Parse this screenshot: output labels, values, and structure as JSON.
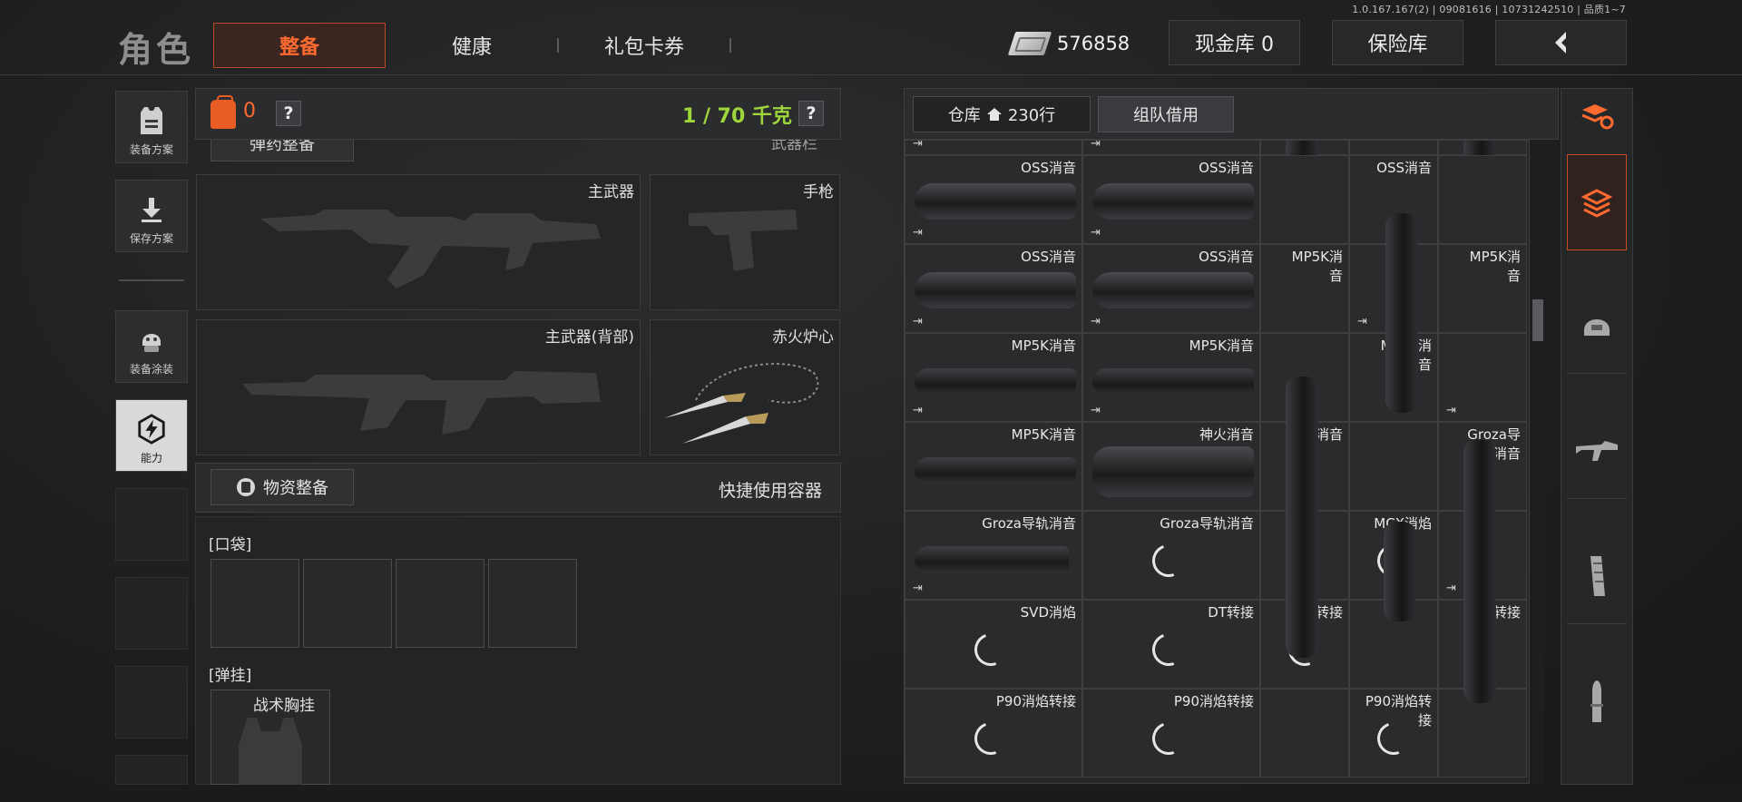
{
  "version": "1.0.167.167(2) | 09081616 | 10731242510 | 品质1~7",
  "header": {
    "title": "角色",
    "tabs": [
      {
        "label": "整备",
        "active": true
      },
      {
        "label": "健康",
        "active": false
      },
      {
        "label": "礼包卡券",
        "active": false
      }
    ],
    "money": "576858",
    "cash_vault": "现金库 0",
    "safe_box": "保险库"
  },
  "left_menu": [
    {
      "label": "装备方案",
      "icon": "vest-icon"
    },
    {
      "label": "保存方案",
      "icon": "download-icon"
    },
    {
      "label": "装备涂装",
      "icon": "helmet-icon"
    },
    {
      "label": "能力",
      "icon": "lightning-icon",
      "active": true
    }
  ],
  "loadout": {
    "backpack_count": "0",
    "help": "?",
    "weight": "1 / 70 千克",
    "peek_button": "弹药整备",
    "peek_right": "武器栏",
    "slots": {
      "primary": "主武器",
      "pistol": "手枪",
      "primary_back": "主武器(背部)",
      "melee": "赤火炉心"
    },
    "supply_button": "物资整备",
    "quick_container": "快捷使用容器",
    "pocket_label": "[口袋]",
    "rig_label": "[弹挂]",
    "rig_item": "战术胸挂"
  },
  "warehouse": {
    "tab_label": "仓库",
    "rows": "230行",
    "team_tab": "组队借用",
    "items": [
      {
        "name": "OSS消音"
      },
      {
        "name": "OSS消音"
      },
      {
        "name": ""
      },
      {
        "name": "OSS消音"
      },
      {
        "name": ""
      },
      {
        "name": "OSS消音"
      },
      {
        "name": "OSS消音"
      },
      {
        "name": "MP5K消\n音"
      },
      {
        "name": ""
      },
      {
        "name": "MP5K消\n音"
      },
      {
        "name": "MP5K消音"
      },
      {
        "name": "MP5K消音"
      },
      {
        "name": ""
      },
      {
        "name": "MP5K消\n音"
      },
      {
        "name": ""
      },
      {
        "name": "MP5K消音"
      },
      {
        "name": "神火消音"
      },
      {
        "name": "神火消音"
      },
      {
        "name": ""
      },
      {
        "name": "Groza导\n轨消音"
      },
      {
        "name": "Groza导轨消音"
      },
      {
        "name": "Groza导轨消音"
      },
      {
        "name": ""
      },
      {
        "name": "MCX消焰"
      },
      {
        "name": ""
      },
      {
        "name": "SVD消焰"
      },
      {
        "name": "DT转接"
      },
      {
        "name": "DT转接"
      },
      {
        "name": ""
      },
      {
        "name": "DT转接"
      },
      {
        "name": "P90消焰转接"
      },
      {
        "name": "P90消焰转接"
      },
      {
        "name": ""
      },
      {
        "name": "P90消焰转\n接"
      },
      {
        "name": ""
      }
    ]
  },
  "right_categories": [
    {
      "icon": "refresh-stack-icon"
    },
    {
      "icon": "all-items-icon",
      "active": true
    },
    {
      "icon": "armor-icon"
    },
    {
      "icon": "rifle-icon"
    },
    {
      "icon": "magazine-icon"
    },
    {
      "icon": "ammo-icon"
    }
  ],
  "colors": {
    "accent_orange": "#ff6a2f",
    "weight_green": "#9ed63b",
    "background": "#1e1f21"
  }
}
